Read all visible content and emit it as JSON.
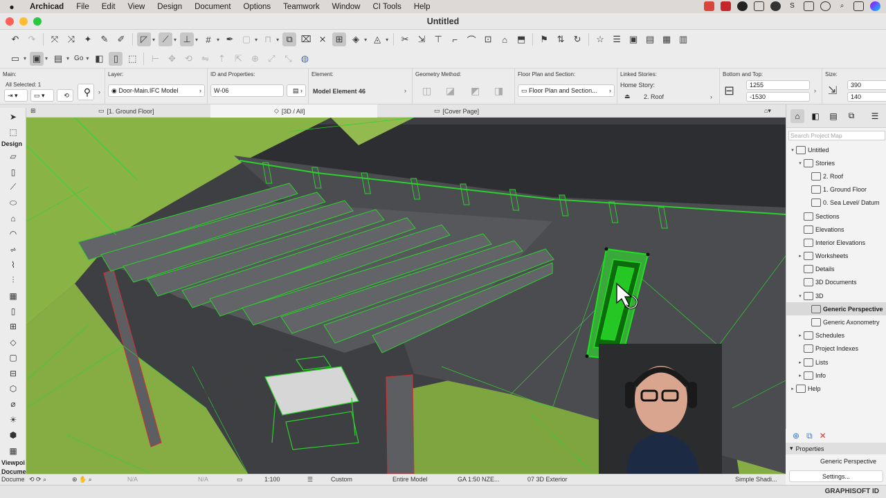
{
  "menubar": {
    "apple": "",
    "items": [
      "Archicad",
      "File",
      "Edit",
      "View",
      "Design",
      "Document",
      "Options",
      "Teamwork",
      "Window",
      "CI Tools",
      "Help"
    ]
  },
  "window": {
    "title": "Untitled"
  },
  "toolbar": {
    "go_label": "Go"
  },
  "infobox": {
    "main_caption": "Main:",
    "all_selected": "All Selected: 1",
    "layer_caption": "Layer:",
    "layer_value": "Door-Main.IFC Model",
    "id_caption": "ID and Properties:",
    "id_value": "W-06",
    "element_caption": "Element:",
    "element_value": "Model Element 46",
    "geometry_caption": "Geometry Method:",
    "floorplan_caption": "Floor Plan and Section:",
    "floorplan_value": "Floor Plan and Section...",
    "linked_caption": "Linked Stories:",
    "home_story_label": "Home Story:",
    "home_story_value": "2. Roof",
    "bottom_top_caption": "Bottom and Top:",
    "top_value": "1255",
    "bottom_value": "-1530",
    "size_caption": "Size:",
    "size_w": "390",
    "size_h": "140"
  },
  "tabs": [
    {
      "label": "[1. Ground Floor]"
    },
    {
      "label": "[3D / All]"
    },
    {
      "label": "[Cover Page]"
    }
  ],
  "toolbox": {
    "design_label": "Design",
    "viewpoint_label": "Viewpoi",
    "document_label": "Docume"
  },
  "statusbar": {
    "na1": "N/A",
    "na2": "N/A",
    "scale": "1:100",
    "custom": "Custom",
    "model": "Entire Model",
    "penset": "GA 1:50 NZE...",
    "view": "07 3D Exterior",
    "shading": "Simple Shadi..."
  },
  "navigator": {
    "search_placeholder": "Search Project Map",
    "tree": [
      {
        "label": "Untitled",
        "level": 0,
        "toggle": "▾"
      },
      {
        "label": "Stories",
        "level": 1,
        "toggle": "▾"
      },
      {
        "label": "2. Roof",
        "level": 2,
        "toggle": ""
      },
      {
        "label": "1. Ground Floor",
        "level": 2,
        "toggle": ""
      },
      {
        "label": "0. Sea Level/ Datum",
        "level": 2,
        "toggle": ""
      },
      {
        "label": "Sections",
        "level": 1,
        "toggle": ""
      },
      {
        "label": "Elevations",
        "level": 1,
        "toggle": ""
      },
      {
        "label": "Interior Elevations",
        "level": 1,
        "toggle": ""
      },
      {
        "label": "Worksheets",
        "level": 1,
        "toggle": "▸"
      },
      {
        "label": "Details",
        "level": 1,
        "toggle": ""
      },
      {
        "label": "3D Documents",
        "level": 1,
        "toggle": ""
      },
      {
        "label": "3D",
        "level": 1,
        "toggle": "▾"
      },
      {
        "label": "Generic Perspective",
        "level": 2,
        "toggle": "",
        "selected": true
      },
      {
        "label": "Generic Axonometry",
        "level": 2,
        "toggle": ""
      },
      {
        "label": "Schedules",
        "level": 1,
        "toggle": "▸"
      },
      {
        "label": "Project Indexes",
        "level": 1,
        "toggle": ""
      },
      {
        "label": "Lists",
        "level": 1,
        "toggle": "▸"
      },
      {
        "label": "Info",
        "level": 1,
        "toggle": "▸"
      },
      {
        "label": "Help",
        "level": 0,
        "toggle": "▸"
      }
    ]
  },
  "properties": {
    "header": "Properties",
    "value": "Generic Perspective",
    "settings_label": "Settings..."
  },
  "footer": {
    "brand": "GRAPHISOFT ID"
  },
  "colors": {
    "ground": "#8bb04a",
    "edge": "#2fd12f",
    "structure": "#5a5b5f",
    "selection": "#19e619"
  }
}
